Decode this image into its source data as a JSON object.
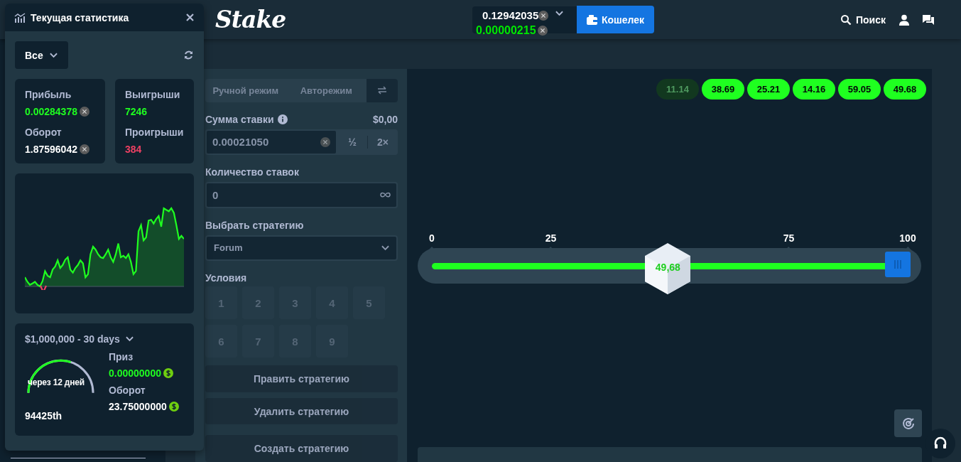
{
  "topbar": {
    "logo": "Stake",
    "balance": "0.12942035",
    "balance_change": "0.00000215",
    "wallet_button": "Кошелек",
    "search": "Поиск"
  },
  "stats_window": {
    "title": "Текущая статистика",
    "filter": "Все",
    "cards": [
      {
        "label": "Прибыль",
        "value": "0.00284378",
        "color": "#1fff20",
        "coin": true
      },
      {
        "label": "Оборот",
        "value": "1.87596042",
        "color": "#ffffff",
        "coin": true
      },
      {
        "label": "Выигрыши",
        "value": "7246",
        "color": "#1fff20",
        "coin": false
      },
      {
        "label": "Проигрыши",
        "value": "384",
        "color": "#ed4163",
        "coin": false
      }
    ],
    "race": {
      "title": "$1,000,000 - 30 days",
      "countdown": "через 12 дней",
      "level": 0.6,
      "rank": "94425th",
      "prize_label": "Приз",
      "prize": "0.00000000",
      "wager_label": "Оборот",
      "wager": "23.75000000"
    }
  },
  "bet_panel": {
    "tabs": [
      {
        "label": "Ручной режим",
        "selected": false
      },
      {
        "label": "Авторежим",
        "selected": false
      }
    ],
    "amount_label": "Сумма ставки",
    "amount_usd": "$0,00",
    "amount": "0.00021050",
    "half": "½",
    "double": "2×",
    "count_label": "Количество ставок",
    "count": "0",
    "strategy_label": "Выбрать стратегию",
    "strategy": "Forum",
    "conditions_label": "Условия",
    "conditions": [
      "1",
      "2",
      "3",
      "4",
      "5",
      "6",
      "7",
      "8",
      "9"
    ],
    "buttons": [
      "Править стратегию",
      "Удалить стратегию",
      "Создать стратегию"
    ]
  },
  "game": {
    "recent": [
      {
        "value": "11.14",
        "faded": true
      },
      {
        "value": "38.69",
        "faded": false
      },
      {
        "value": "25.21",
        "faded": false
      },
      {
        "value": "14.16",
        "faded": false
      },
      {
        "value": "59.05",
        "faded": false
      },
      {
        "value": "49.68",
        "faded": false
      }
    ],
    "ticks": [
      "0",
      "25",
      "75",
      "100"
    ],
    "result": "49,68",
    "result_position": {
      "level": 0.4968
    },
    "slider": {
      "level": 0.98
    }
  }
}
